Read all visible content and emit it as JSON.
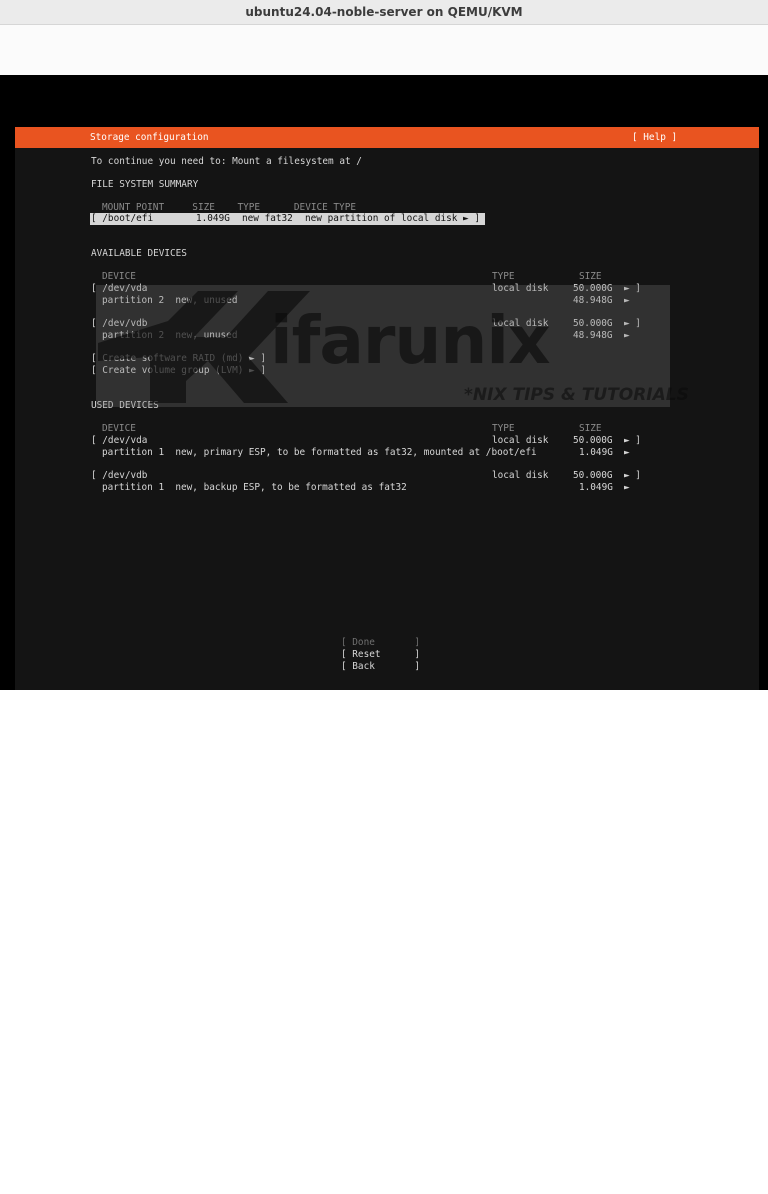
{
  "window": {
    "title": "ubuntu24.04-noble-server on QEMU/KVM"
  },
  "header": {
    "title": "Storage configuration",
    "help": "[ Help ]"
  },
  "message": "To continue you need to: Mount a filesystem at /",
  "fs_summary": {
    "heading": "FILE SYSTEM SUMMARY",
    "columns": "MOUNT POINT     SIZE    TYPE      DEVICE TYPE",
    "row": {
      "mount": "[ /boot/efi",
      "size": "1.049G",
      "type": "new fat32",
      "device_type": "new partition of local disk ► ]"
    }
  },
  "available": {
    "heading": "AVAILABLE DEVICES",
    "col_device": "DEVICE",
    "col_type": "TYPE",
    "col_size": "SIZE",
    "vda": {
      "name": "[ /dev/vda",
      "type": "local disk",
      "size": "50.000G",
      "arrow": "► ]"
    },
    "vda_p2": {
      "name": "partition 2  new, unused",
      "size": "48.948G",
      "arrow": "►"
    },
    "vdb": {
      "name": "[ /dev/vdb",
      "type": "local disk",
      "size": "50.000G",
      "arrow": "► ]"
    },
    "vdb_p2": {
      "name": "partition 2  new, unused",
      "size": "48.948G",
      "arrow": "►"
    },
    "raid": "[ Create software RAID (md) ► ]",
    "lvm": "[ Create volume group (LVM) ► ]"
  },
  "used": {
    "heading": "USED DEVICES",
    "col_device": "DEVICE",
    "col_type": "TYPE",
    "col_size": "SIZE",
    "vda": {
      "name": "[ /dev/vda",
      "type": "local disk",
      "size": "50.000G",
      "arrow": "► ]"
    },
    "vda_p1": {
      "name": "partition 1  new, primary ESP, to be formatted as fat32, mounted at /boot/efi",
      "size": "1.049G",
      "arrow": "►"
    },
    "vdb": {
      "name": "[ /dev/vdb",
      "type": "local disk",
      "size": "50.000G",
      "arrow": "► ]"
    },
    "vdb_p1": {
      "name": "partition 1  new, backup ESP, to be formatted as fat32",
      "size": "1.049G",
      "arrow": "►"
    }
  },
  "buttons": {
    "done": "[ Done       ]",
    "reset": "[ Reset      ]",
    "back": "[ Back       ]"
  },
  "watermark": {
    "brand": "ifarunix",
    "tagline": "*NIX TIPS & TUTORIALS"
  },
  "colors": {
    "accent": "#e95420",
    "terminal_bg": "#141414",
    "terminal_text": "#d6d6d6"
  }
}
